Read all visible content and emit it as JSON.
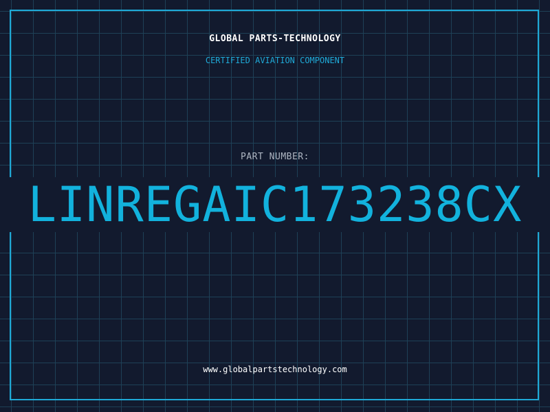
{
  "header": {
    "company": "GLOBAL PARTS-TECHNOLOGY",
    "tagline": "CERTIFIED AVIATION COMPONENT"
  },
  "part": {
    "label": "PART NUMBER:",
    "number": "LINREGAIC173238CX"
  },
  "footer": {
    "website": "www.globalpartstechnology.com"
  },
  "colors": {
    "background": "#121a2e",
    "grid": "#1e4157",
    "accent": "#1faad8",
    "part_number": "#12b2dd"
  }
}
